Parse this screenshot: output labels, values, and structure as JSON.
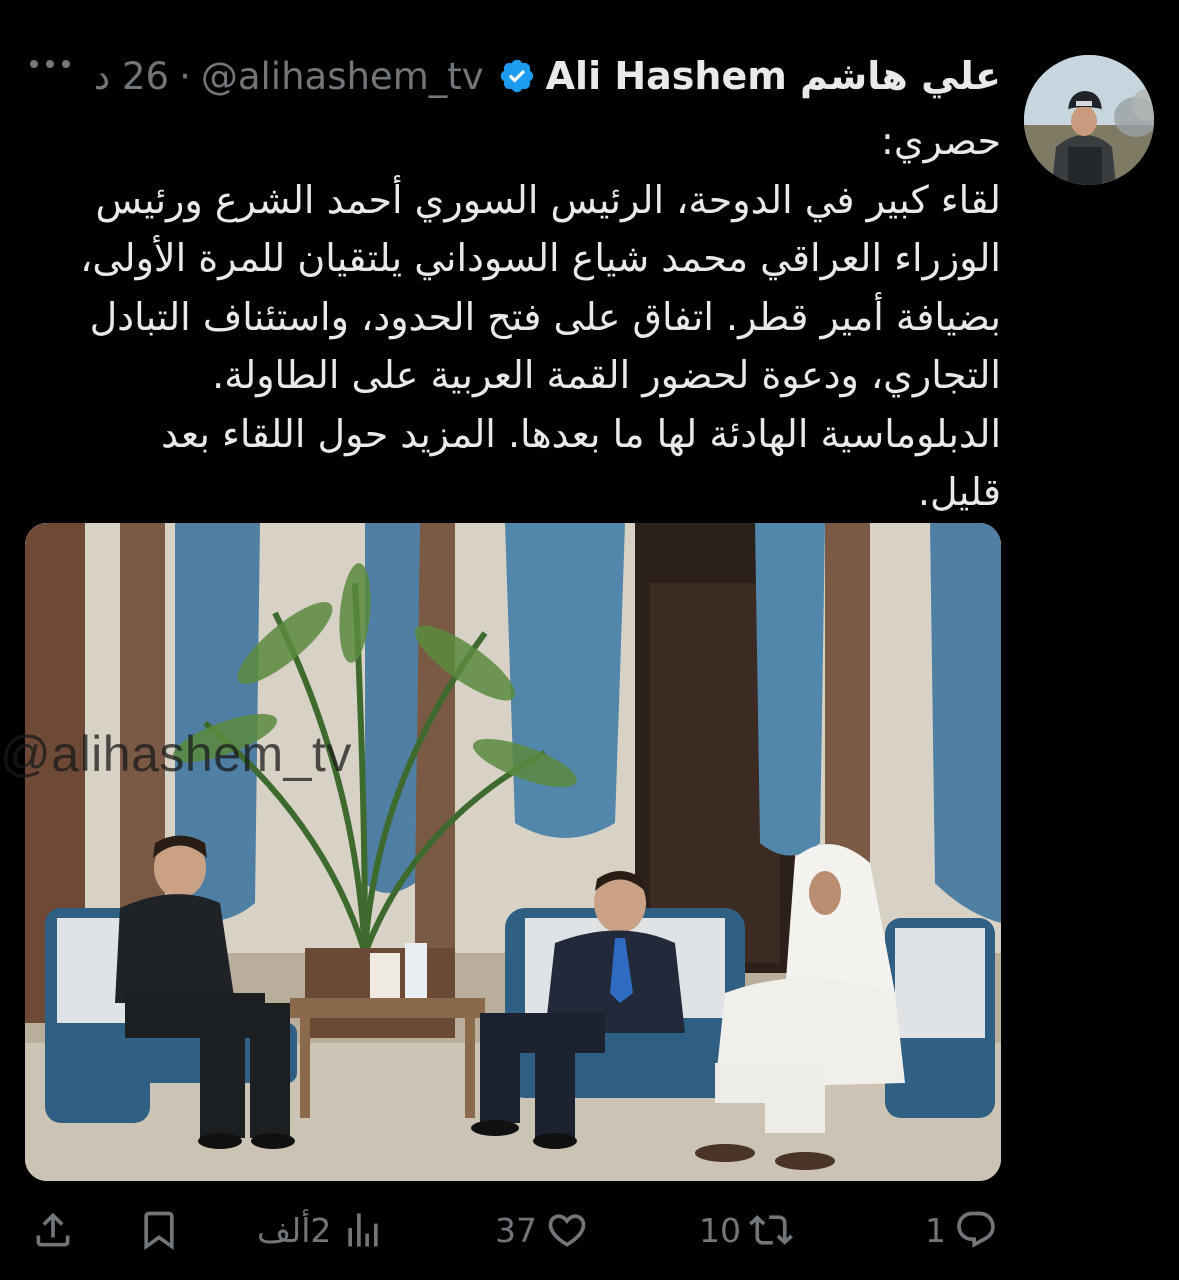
{
  "author": {
    "display_name": "علي هاشم Ali Hashem",
    "handle": "@alihashem_tv",
    "separator": "·",
    "time": "26 د",
    "verified": true
  },
  "tweet": {
    "lines": [
      "حصري:",
      "لقاء كبير في الدوحة، الرئيس السوري أحمد الشرع ورئيس",
      "الوزراء العراقي محمد شياع السوداني يلتقيان للمرة الأولى،",
      "بضيافة أمير قطر. اتفاق على فتح الحدود، واستئناف التبادل",
      "التجاري، ودعوة لحضور القمة العربية على الطاولة.",
      "الدبلوماسية الهادئة لها ما بعدها. المزيد حول اللقاء بعد",
      "قليل."
    ]
  },
  "media": {
    "watermark": "@alihashem_tv"
  },
  "actions": {
    "reply": {
      "count": "1",
      "icon": "reply-icon"
    },
    "retweet": {
      "count": "10",
      "icon": "retweet-icon"
    },
    "like": {
      "count": "37",
      "icon": "heart-icon"
    },
    "views": {
      "count": "2ألف",
      "icon": "views-icon"
    },
    "bookmark": {
      "icon": "bookmark-icon"
    },
    "share": {
      "icon": "share-icon"
    }
  },
  "colors": {
    "background": "#000000",
    "text": "#e7e9ea",
    "secondary": "#71767b",
    "verified": "#1d9bf0"
  }
}
